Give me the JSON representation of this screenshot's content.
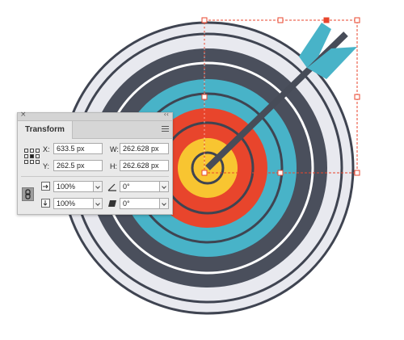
{
  "panel": {
    "title_tab": "Transform",
    "close_glyph": "×",
    "collapse_glyph": "‹‹",
    "fields": {
      "x_label": "X:",
      "x_value": "633.5 px",
      "y_label": "Y:",
      "y_value": "262.5 px",
      "w_label": "W:",
      "w_value": "262.628 px",
      "h_label": "H:",
      "h_value": "262.628 px",
      "scale_x": "100%",
      "scale_y": "100%",
      "rotate": "0°",
      "shear": "0°"
    },
    "icons": {
      "menu": "panel-menu-icon",
      "reference_point": "reference-point-icon",
      "constrain": "link-icon",
      "scale_x": "scale-horizontal-icon",
      "scale_y": "scale-vertical-icon",
      "rotate": "rotate-angle-icon",
      "shear": "shear-icon"
    }
  },
  "colors": {
    "background": "#ffffff",
    "ring_light": "#e8e9ef",
    "ring_dark": "#4a4f5c",
    "ring_teal": "#48b3c8",
    "ring_red": "#e8452c",
    "ring_yellow": "#f8c531",
    "outline": "#3f4451",
    "arrow_shaft": "#474c58",
    "fletching": "#48b3c8",
    "selection": "#e8452c"
  }
}
